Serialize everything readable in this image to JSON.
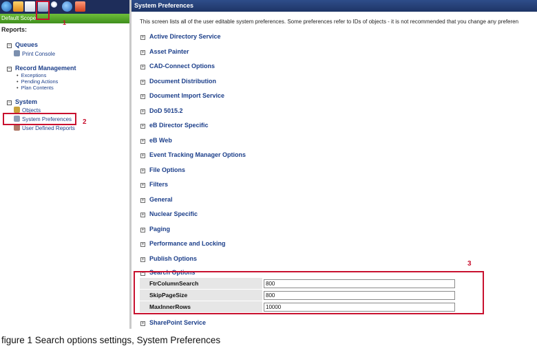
{
  "left_panel": {
    "scope_label": "Default Scope:",
    "reports_heading": "Reports:",
    "groups": [
      {
        "label": "Queues",
        "items": [
          {
            "label": "Print Console"
          }
        ]
      },
      {
        "label": "Record Management",
        "items": [
          {
            "label": "Exceptions"
          },
          {
            "label": "Pending Actions"
          },
          {
            "label": "Plan Contents"
          }
        ]
      },
      {
        "label": "System",
        "items": [
          {
            "label": "Objects"
          },
          {
            "label": "System Preferences"
          },
          {
            "label": "User Defined Reports"
          }
        ]
      }
    ],
    "toolbar_icons": [
      "globe-icon",
      "home-icon",
      "document-icon",
      "tools-icon",
      "search-icon",
      "help-icon",
      "close-icon"
    ]
  },
  "main": {
    "header_title": "System Preferences",
    "intro_text": "This screen lists all of the user editable system preferences. Some preferences refer to IDs of objects - it is not recommended that you change any preferen",
    "sections": [
      {
        "label": "Active Directory Service"
      },
      {
        "label": "Asset Painter"
      },
      {
        "label": "CAD-Connect Options"
      },
      {
        "label": "Document Distribution"
      },
      {
        "label": "Document Import Service"
      },
      {
        "label": "DoD 5015.2"
      },
      {
        "label": "eB Director Specific"
      },
      {
        "label": "eB Web"
      },
      {
        "label": "Event Tracking Manager Options"
      },
      {
        "label": "File Options"
      },
      {
        "label": "Filters"
      },
      {
        "label": "General"
      },
      {
        "label": "Nuclear Specific"
      },
      {
        "label": "Paging"
      },
      {
        "label": "Performance and Locking"
      },
      {
        "label": "Publish Options"
      }
    ],
    "search_options": {
      "label": "Search Options",
      "settings": [
        {
          "name": "FtrColumnSearch",
          "value": "800"
        },
        {
          "name": "SkipPageSize",
          "value": "800"
        },
        {
          "name": "MaxInnerRows",
          "value": "10000"
        }
      ]
    },
    "after_sections": [
      {
        "label": "SharePoint Service"
      }
    ]
  },
  "annotations": {
    "marker_1": "1",
    "marker_2": "2",
    "marker_3": "3",
    "color": "#c8102e"
  },
  "caption": "figure 1 Search options settings, System Preferences",
  "colors": {
    "header_bg": "#1e3566",
    "scope_bar": "#4e9e28",
    "link_blue": "#1c3f8a"
  }
}
